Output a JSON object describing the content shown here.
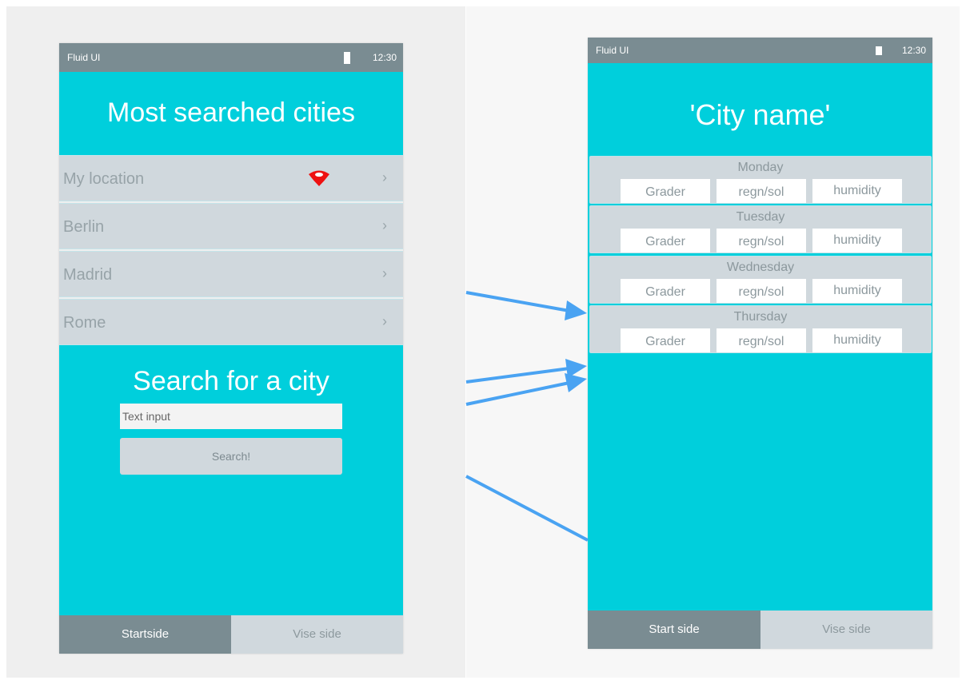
{
  "left_phone": {
    "status": {
      "app_name": "Fluid UI",
      "time": "12:30"
    },
    "title": "Most searched cities",
    "cities": [
      {
        "label": "My location",
        "chevron": "›",
        "icon": "location-pin-icon"
      },
      {
        "label": "Berlin",
        "chevron": "›"
      },
      {
        "label": "Madrid",
        "chevron": "›"
      },
      {
        "label": "Rome",
        "chevron": "›"
      }
    ],
    "search": {
      "title": "Search for a city",
      "input_value": "Text input",
      "button_label": "Search!"
    },
    "tabs": [
      {
        "label": "Startside",
        "active": true
      },
      {
        "label": "Vise side",
        "active": false
      }
    ]
  },
  "right_phone": {
    "status": {
      "app_name": "Fluid UI",
      "time": "12:30"
    },
    "title": "'City  name'",
    "days": [
      {
        "name": "Monday",
        "cells": [
          "Grader",
          "regn/sol",
          "humidity"
        ]
      },
      {
        "name": "Tuesday",
        "cells": [
          "Grader",
          "regn/sol",
          "humidity"
        ]
      },
      {
        "name": "Wednesday",
        "cells": [
          "Grader",
          "regn/sol",
          "humidity"
        ]
      },
      {
        "name": "Thursday",
        "cells": [
          "Grader",
          "regn/sol",
          "humidity"
        ]
      }
    ],
    "tabs": [
      {
        "label": "Start side",
        "active": true
      },
      {
        "label": "Vise side",
        "active": false
      }
    ]
  },
  "colors": {
    "primary": "#00cfdc",
    "status_bar": "#7a8c92",
    "list_item": "#d0d8dd",
    "arrow": "#4aa3f2",
    "pin": "#ee1111"
  }
}
